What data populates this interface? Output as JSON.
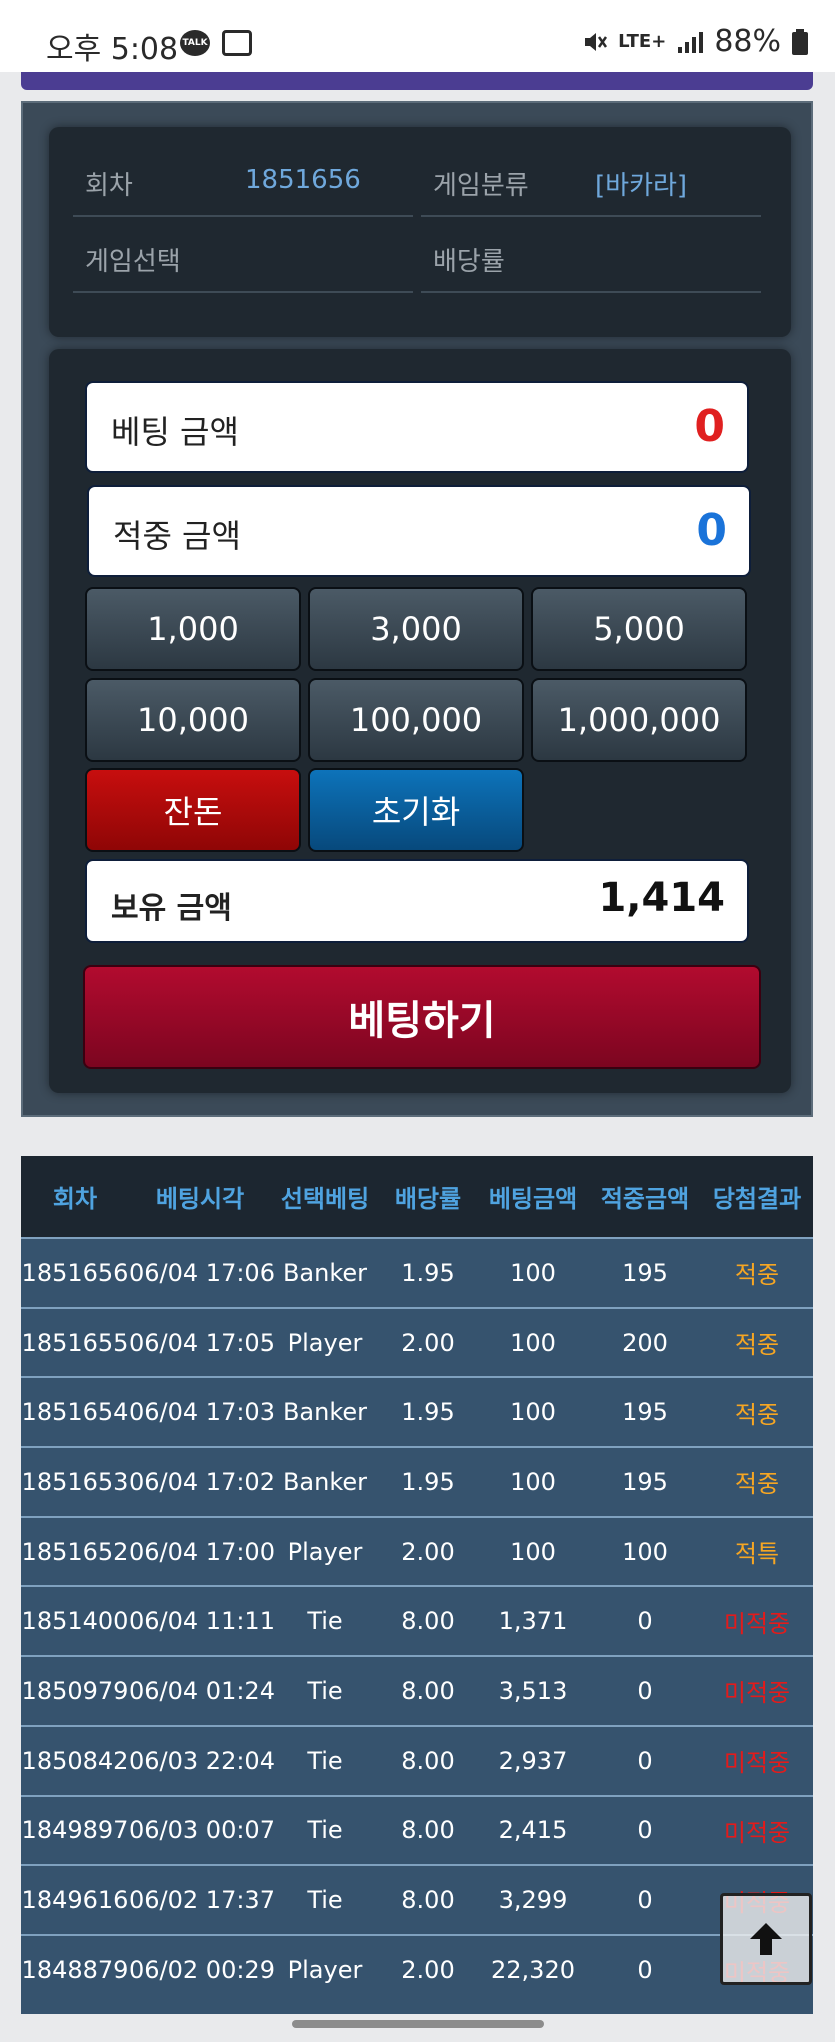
{
  "status_bar": {
    "time": "오후 5:08",
    "talk_icon_text": "TALK",
    "network": "LTE+",
    "battery": "88%"
  },
  "info": {
    "round_label": "회차",
    "round_value": "1851656",
    "category_label": "게임분류",
    "category_value": "[바카라]",
    "selection_label": "게임선택",
    "odds_label": "배당률"
  },
  "betting": {
    "bet_amount_label": "베팅 금액",
    "bet_amount_value": "0",
    "win_amount_label": "적중 금액",
    "win_amount_value": "0",
    "chips": [
      "1,000",
      "3,000",
      "5,000",
      "10,000",
      "100,000",
      "1,000,000"
    ],
    "change_label": "잔돈",
    "reset_label": "초기화",
    "balance_label": "보유 금액",
    "balance_value": "1,414",
    "submit_label": "베팅하기"
  },
  "history": {
    "headers": [
      "회차",
      "베팅시각",
      "선택베팅",
      "배당률",
      "베팅금액",
      "적중금액",
      "당첨결과"
    ],
    "rows": [
      [
        "1851656",
        "06/04 17:06",
        "Banker",
        "1.95",
        "100",
        "195",
        "적중"
      ],
      [
        "1851655",
        "06/04 17:05",
        "Player",
        "2.00",
        "100",
        "200",
        "적중"
      ],
      [
        "1851654",
        "06/04 17:03",
        "Banker",
        "1.95",
        "100",
        "195",
        "적중"
      ],
      [
        "1851653",
        "06/04 17:02",
        "Banker",
        "1.95",
        "100",
        "195",
        "적중"
      ],
      [
        "1851652",
        "06/04 17:00",
        "Player",
        "2.00",
        "100",
        "100",
        "적특"
      ],
      [
        "1851400",
        "06/04 11:11",
        "Tie",
        "8.00",
        "1,371",
        "0",
        "미적중"
      ],
      [
        "1850979",
        "06/04 01:24",
        "Tie",
        "8.00",
        "3,513",
        "0",
        "미적중"
      ],
      [
        "1850842",
        "06/03 22:04",
        "Tie",
        "8.00",
        "2,937",
        "0",
        "미적중"
      ],
      [
        "1849897",
        "06/03 00:07",
        "Tie",
        "8.00",
        "2,415",
        "0",
        "미적중"
      ],
      [
        "1849616",
        "06/02 17:37",
        "Tie",
        "8.00",
        "3,299",
        "0",
        "미적중"
      ],
      [
        "1848879",
        "06/02 00:29",
        "Player",
        "2.00",
        "22,320",
        "0",
        "미적중"
      ]
    ]
  },
  "colors": {
    "hit": "#f6a623",
    "miss": "#e21b1b",
    "header_text": "#4fa3e0",
    "bet_amount": "#e02020",
    "win_amount": "#1a73d9"
  },
  "icons": {
    "scroll_top": "arrow-up-icon"
  }
}
